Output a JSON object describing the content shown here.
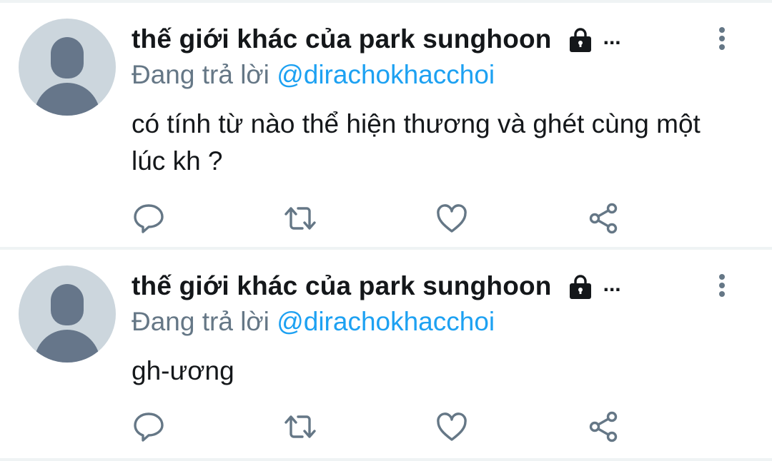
{
  "tweets": [
    {
      "display_name": "thế giới khác của park sunghoon",
      "ellipsis": "...",
      "replying_prefix": "Đang trả lời ",
      "replying_handle": "@dirachokhacchoi",
      "text": "có tính từ nào thể hiện thương và ghét cùng một lúc kh ?",
      "icons": {
        "lock": "lock-icon",
        "more": "more-vertical-icon",
        "reply": "reply-icon",
        "retweet": "retweet-icon",
        "like": "heart-icon",
        "share": "share-icon"
      }
    },
    {
      "display_name": "thế giới khác của park sunghoon",
      "ellipsis": "...",
      "replying_prefix": "Đang trả lời ",
      "replying_handle": "@dirachokhacchoi",
      "text": "gh-ương",
      "icons": {
        "lock": "lock-icon",
        "more": "more-vertical-icon",
        "reply": "reply-icon",
        "retweet": "retweet-icon",
        "like": "heart-icon",
        "share": "share-icon"
      }
    }
  ],
  "colors": {
    "text_primary": "#14171a",
    "text_secondary": "#657786",
    "link": "#1da1f2",
    "icon": "#657786",
    "divider": "#eff3f4",
    "avatar_bg": "#ccd6dd",
    "avatar_fg": "#66768a"
  }
}
